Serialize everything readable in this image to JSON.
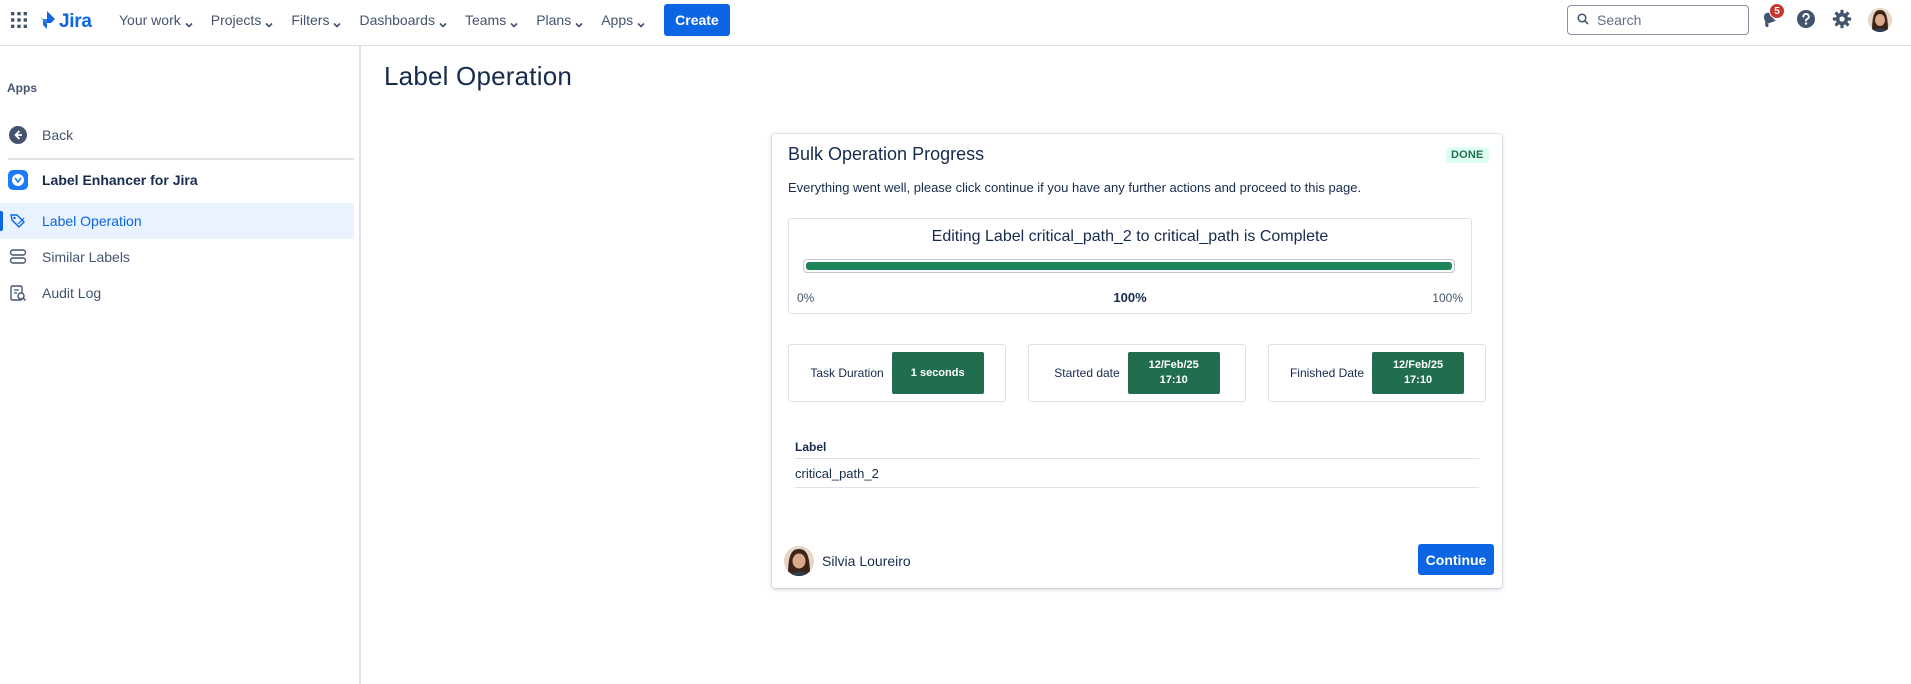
{
  "topbar": {
    "app_switcher_icon": "grid-icon",
    "logo_text": "Jira",
    "nav": [
      {
        "label": "Your work"
      },
      {
        "label": "Projects"
      },
      {
        "label": "Filters"
      },
      {
        "label": "Dashboards"
      },
      {
        "label": "Teams"
      },
      {
        "label": "Plans"
      },
      {
        "label": "Apps"
      }
    ],
    "create_label": "Create",
    "search_placeholder": "Search",
    "notification_count": "5",
    "accent": "#0c66e4"
  },
  "sidebar": {
    "heading": "Apps",
    "back_label": "Back",
    "app_name": "Label Enhancer for Jira",
    "items": [
      {
        "label": "Label Operation",
        "icon": "label-edit-icon",
        "active": true
      },
      {
        "label": "Similar Labels",
        "icon": "stack-icon",
        "active": false
      },
      {
        "label": "Audit Log",
        "icon": "audit-log-icon",
        "active": false
      }
    ]
  },
  "main": {
    "page_title": "Label Operation",
    "card": {
      "title": "Bulk Operation Progress",
      "status": "DONE",
      "description": "Everything went well, please click continue if you have any further actions and proceed to this page.",
      "progress": {
        "title": "Editing Label critical_path_2 to critical_path is Complete",
        "value_percent": 100,
        "min_label": "0%",
        "center_label": "100%",
        "max_label": "100%"
      },
      "stats": [
        {
          "label": "Task Duration",
          "value": "1 seconds"
        },
        {
          "label": "Started date",
          "value": "12/Feb/25 17:10"
        },
        {
          "label": "Finished Date",
          "value": "12/Feb/25 17:10"
        }
      ],
      "table": {
        "header": "Label",
        "rows": [
          "critical_path_2"
        ]
      },
      "user_name": "Silvia Loureiro",
      "continue_label": "Continue"
    }
  },
  "colors": {
    "success_green": "#216e4e",
    "progress_green": "#1f845a",
    "active_bg": "#e9f2ff"
  }
}
